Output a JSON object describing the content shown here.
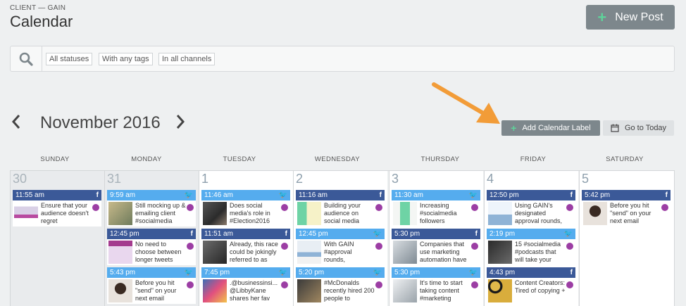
{
  "header": {
    "client": "CLIENT — GAIN",
    "title": "Calendar",
    "new_post": "New Post"
  },
  "filters": {
    "statuses": "All statuses",
    "tags": "With any tags",
    "channels": "In all channels"
  },
  "nav": {
    "month": "November 2016",
    "prev": "‹",
    "next": "›"
  },
  "toolbar": {
    "add_label": "Add Calendar Label",
    "today": "Go to Today"
  },
  "days": [
    "SUNDAY",
    "MONDAY",
    "TUESDAY",
    "WEDNESDAY",
    "THURSDAY",
    "FRIDAY",
    "SATURDAY"
  ],
  "dates": [
    "30",
    "31",
    "1",
    "2",
    "3",
    "4",
    "5"
  ],
  "posts": {
    "sun": [
      {
        "time": "11:55 am",
        "network": "f",
        "text": "Ensure that your audience doesn't regret"
      }
    ],
    "mon": [
      {
        "time": "9:59 am",
        "network": "t",
        "text": "Still mocking up & emailing client #socialmedia"
      },
      {
        "time": "12:45 pm",
        "network": "f",
        "text": "No need to choose between longer tweets"
      },
      {
        "time": "5:43 pm",
        "network": "t",
        "text": "Before you hit \"send\" on your next email"
      }
    ],
    "tue": [
      {
        "time": "11:46 am",
        "network": "t",
        "text": "Does social media's role in #Election2016"
      },
      {
        "time": "11:51 am",
        "network": "f",
        "text": "Already, this race could be jokingly referred to as"
      },
      {
        "time": "7:45 pm",
        "network": "t",
        "text": ".@businessinsi... @LibbyKane shares her fav"
      }
    ],
    "wed": [
      {
        "time": "11:16 am",
        "network": "f",
        "text": "Building your audience on social media"
      },
      {
        "time": "12:45 pm",
        "network": "t",
        "text": "With GAIN #approval rounds,"
      },
      {
        "time": "5:20 pm",
        "network": "t",
        "text": "#McDonalds recently hired 200 people to"
      }
    ],
    "thu": [
      {
        "time": "11:30 am",
        "network": "t",
        "text": "Increasing #socialmedia followers"
      },
      {
        "time": "5:30 pm",
        "network": "f",
        "text": "Companies that use marketing automation have"
      },
      {
        "time": "5:30 pm",
        "network": "t",
        "text": "It's time to start taking content #marketing"
      }
    ],
    "fri": [
      {
        "time": "12:50 pm",
        "network": "f",
        "text": "Using GAIN's designated approval rounds,"
      },
      {
        "time": "2:19 pm",
        "network": "t",
        "text": "15 #socialmedia #podcasts that will take your"
      },
      {
        "time": "4:43 pm",
        "network": "f",
        "text": "Content Creators: Tired of copying +"
      }
    ],
    "sat": [
      {
        "time": "5:42 pm",
        "network": "f",
        "text": "Before you hit \"send\" on your next email"
      }
    ]
  },
  "colors": {
    "facebook": "#3b5998",
    "twitter": "#55acee",
    "accent": "#5ed39a",
    "status_dot": "#9c3ea4",
    "arrow": "#f29c38"
  }
}
